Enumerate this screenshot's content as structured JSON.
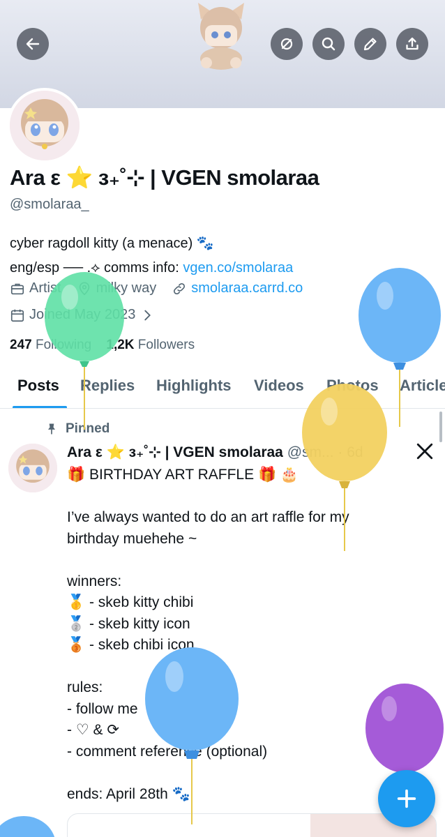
{
  "profile": {
    "name": "Ara ε ⭐ з₊˚⊹ | VGEN smolaraa",
    "handle": "@smolaraa_",
    "bio_line1": "cyber ragdoll kitty (a menace) 🐾",
    "bio_line2_prefix": "eng/esp ── .⟡ comms info: ",
    "bio_link": "vgen.co/smolaraa",
    "category": "Artist",
    "location": "milky way",
    "website": "smolaraa.carrd.co",
    "joined": "Joined May 2023",
    "following_count": "247",
    "following_label": "Following",
    "followers_count": "1,2K",
    "followers_label": "Followers"
  },
  "tabs": [
    "Posts",
    "Replies",
    "Highlights",
    "Videos",
    "Photos",
    "Articles"
  ],
  "icons": {
    "back": "arrow-left-icon",
    "grok": "grok-icon",
    "search": "search-icon",
    "edit": "pencil-icon",
    "share": "share-icon",
    "pin": "pin-icon",
    "x_logo": "x-logo-icon",
    "compose": "plus-icon"
  },
  "post": {
    "pinned_label": "Pinned",
    "author_name": "Ara ε ⭐ з₊˚⊹ | VGEN smolaraa",
    "author_handle": "@sm...",
    "time": "· 6d",
    "text": "🎁 BIRTHDAY ART RAFFLE 🎁 🎂\n\nI’ve always wanted to do an art raffle for my\nbirthday muehehe ~\n\nwinners:\n🥇 - skeb kitty chibi\n🥈 - skeb kitty icon\n🥉 - skeb chibi icon\n\nrules:\n- follow me\n- ♡ & ⟳\n- comment reference (optional)\n\nends: April 28th 🐾"
  },
  "colors": {
    "accent": "#1d9bf0",
    "muted_text": "#536471",
    "balloon_green": "#5ee0a5",
    "balloon_blue": "#6cb6f7",
    "balloon_yellow": "#f2d160",
    "balloon_purple": "#a55bd8"
  }
}
